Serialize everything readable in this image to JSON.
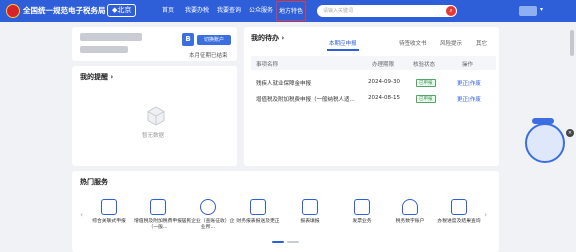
{
  "header": {
    "site_title": "全国统一规范电子税务局",
    "region": "◆北京",
    "nav": [
      "首页",
      "我要办税",
      "我要查询",
      "公众服务",
      "地方特色"
    ],
    "search_placeholder": "请输入关键词",
    "colors": {
      "brand": "#2f5fd8",
      "highlight": "#e53935"
    }
  },
  "profile": {
    "badge": "B",
    "switch_label": "切换账户",
    "note": "本月征期已结束"
  },
  "reminders": {
    "title": "我的提醒 ›",
    "empty_text": "暂无数据"
  },
  "todo": {
    "title": "我的待办 ›",
    "tabs": [
      "本期应申报",
      "待签收文书",
      "风险提示",
      "其它"
    ],
    "columns": [
      "事项名称",
      "办理期限",
      "核验状态",
      "操作"
    ],
    "rows": [
      {
        "name": "残疾人就业保障金申报",
        "deadline": "2024-09-30",
        "status": "已申报",
        "action": "更正|作废"
      },
      {
        "name": "增值税及附加税费申报（一般纳税人适...",
        "deadline": "2024-08-15",
        "status": "已申报",
        "action": "更正|作废"
      }
    ]
  },
  "hot_services": {
    "title": "热门服务",
    "items": [
      {
        "label": "综合关联式申报",
        "icon": "form-icon"
      },
      {
        "label": "增值税及附加税费申报（一般...",
        "icon": "document-icon"
      },
      {
        "label": "居民企业（查账征收）企业所...",
        "icon": "building-icon"
      },
      {
        "label": "财务报表报送及更正",
        "icon": "report-icon"
      },
      {
        "label": "报表填报",
        "icon": "doc-edit-icon"
      },
      {
        "label": "发票业务",
        "icon": "invoice-icon"
      },
      {
        "label": "税务数字账户",
        "icon": "user-123-icon"
      },
      {
        "label": "办税进度及结果查询",
        "icon": "search-doc-icon"
      }
    ]
  }
}
